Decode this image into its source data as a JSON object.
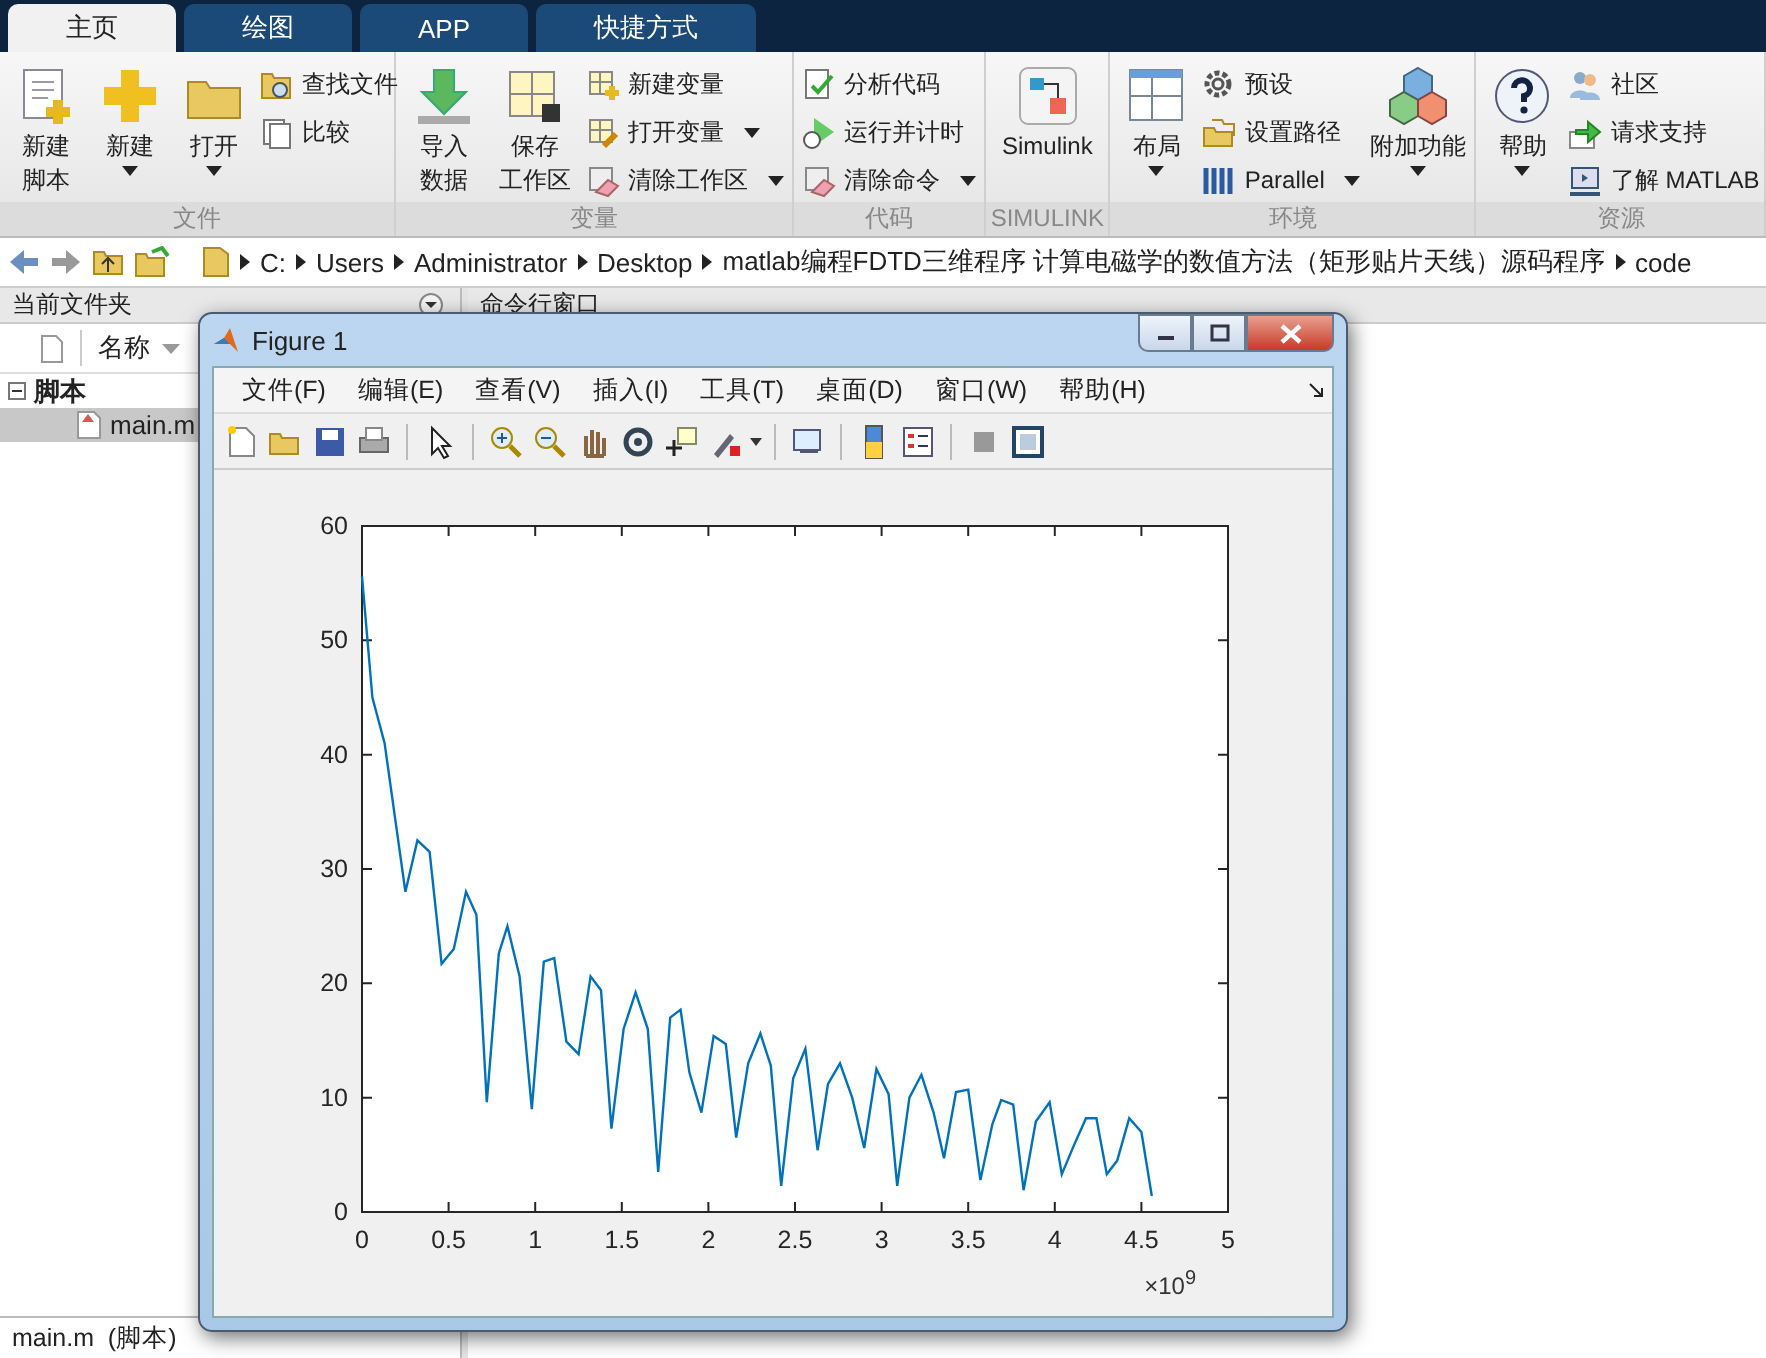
{
  "tabs": [
    {
      "label": "主页",
      "selected": true
    },
    {
      "label": "绘图",
      "selected": false
    },
    {
      "label": "APP",
      "selected": false
    },
    {
      "label": "快捷方式",
      "selected": false
    }
  ],
  "ribbon": {
    "groups": [
      {
        "label": "文件",
        "items": [
          {
            "kind": "large",
            "lines": [
              "新建",
              "脚本"
            ],
            "dropdown": false
          },
          {
            "kind": "large",
            "lines": [
              "新建"
            ],
            "dropdown": true
          },
          {
            "kind": "large",
            "lines": [
              "打开"
            ],
            "dropdown": true
          },
          {
            "kind": "small",
            "label": "查找文件",
            "dropdown": false
          },
          {
            "kind": "small",
            "label": "比较",
            "dropdown": false
          }
        ]
      },
      {
        "label": "变量",
        "items": [
          {
            "kind": "large",
            "lines": [
              "导入",
              "数据"
            ],
            "dropdown": false
          },
          {
            "kind": "large",
            "lines": [
              "保存",
              "工作区"
            ],
            "dropdown": false
          },
          {
            "kind": "small",
            "label": "新建变量",
            "dropdown": false
          },
          {
            "kind": "small",
            "label": "打开变量",
            "dropdown": true
          },
          {
            "kind": "small",
            "label": "清除工作区",
            "dropdown": true
          }
        ]
      },
      {
        "label": "代码",
        "items": [
          {
            "kind": "small",
            "label": "分析代码",
            "dropdown": false
          },
          {
            "kind": "small",
            "label": "运行并计时",
            "dropdown": false
          },
          {
            "kind": "small",
            "label": "清除命令",
            "dropdown": true
          }
        ]
      },
      {
        "label": "SIMULINK",
        "items": [
          {
            "kind": "large",
            "lines": [
              "Simulink"
            ],
            "dropdown": false
          }
        ]
      },
      {
        "label": "环境",
        "items": [
          {
            "kind": "large",
            "lines": [
              "布局"
            ],
            "dropdown": true
          },
          {
            "kind": "small",
            "label": "预设",
            "dropdown": false
          },
          {
            "kind": "small",
            "label": "设置路径",
            "dropdown": false
          },
          {
            "kind": "small",
            "label": "Parallel",
            "dropdown": true
          },
          {
            "kind": "large",
            "lines": [
              "附加功能"
            ],
            "dropdown": true
          }
        ]
      },
      {
        "label": "资源",
        "items": [
          {
            "kind": "large",
            "lines": [
              "帮助"
            ],
            "dropdown": true
          },
          {
            "kind": "small",
            "label": "社区",
            "dropdown": false
          },
          {
            "kind": "small",
            "label": "请求支持",
            "dropdown": false
          },
          {
            "kind": "small",
            "label": "了解 MATLAB",
            "dropdown": false
          }
        ]
      }
    ]
  },
  "path": [
    "C:",
    "Users",
    "Administrator",
    "Desktop",
    "matlab编程FDTD三维程序 计算电磁学的数值方法（矩形贴片天线）源码程序",
    "code"
  ],
  "file_panel": {
    "title": "当前文件夹",
    "column": "名称",
    "tree": [
      {
        "label": "脚本",
        "expanded": true,
        "children": [
          {
            "label": "main.m",
            "selected": true
          }
        ]
      }
    ],
    "details": "main.m  (脚本)"
  },
  "command_window": {
    "title": "命令行窗口"
  },
  "figure": {
    "title": "Figure 1",
    "menu": [
      "文件(F)",
      "编辑(E)",
      "查看(V)",
      "插入(I)",
      "工具(T)",
      "桌面(D)",
      "窗口(W)",
      "帮助(H)"
    ],
    "chart_data": {
      "type": "line",
      "x": [
        0,
        0.06,
        0.13,
        0.25,
        0.32,
        0.39,
        0.46,
        0.53,
        0.6,
        0.66,
        0.72,
        0.79,
        0.84,
        0.91,
        0.98,
        1.05,
        1.11,
        1.18,
        1.25,
        1.32,
        1.38,
        1.44,
        1.51,
        1.58,
        1.65,
        1.71,
        1.78,
        1.84,
        1.89,
        1.96,
        2.03,
        2.1,
        2.16,
        2.23,
        2.3,
        2.36,
        2.42,
        2.49,
        2.56,
        2.63,
        2.69,
        2.76,
        2.83,
        2.9,
        2.97,
        3.04,
        3.09,
        3.16,
        3.23,
        3.3,
        3.36,
        3.43,
        3.5,
        3.57,
        3.64,
        3.69,
        3.76,
        3.82,
        3.89,
        3.97,
        4.04,
        4.11,
        4.18,
        4.24,
        4.3,
        4.36,
        4.43,
        4.5,
        4.56
      ],
      "series": [
        {
          "color": "#0072bd",
          "values": [
            55.6,
            45,
            41,
            28,
            32.5,
            31.5,
            21.7,
            23,
            28,
            26,
            9.6,
            22.6,
            25,
            20.6,
            9,
            21.9,
            22.2,
            14.9,
            13.8,
            20.6,
            19.4,
            7.3,
            16,
            19.2,
            16,
            3.5,
            17,
            17.7,
            12.2,
            8.7,
            15.4,
            14.7,
            6.5,
            13,
            15.6,
            12.8,
            2.3,
            11.7,
            14.3,
            5.4,
            11.2,
            13,
            10,
            5.6,
            12.5,
            10.3,
            2.3,
            10,
            12,
            8.7,
            4.7,
            10.5,
            10.7,
            2.8,
            7.7,
            9.8,
            9.4,
            1.9,
            7.9,
            9.6,
            3.3,
            5.8,
            8.2,
            8.2,
            3.3,
            4.5,
            8.2,
            7,
            1.4
          ]
        }
      ],
      "xlim": [
        0,
        5
      ],
      "ylim": [
        0,
        60
      ],
      "xticks": [
        0,
        0.5,
        1,
        1.5,
        2,
        2.5,
        3,
        3.5,
        4,
        4.5,
        5
      ],
      "yticks": [
        0,
        10,
        20,
        30,
        40,
        50,
        60
      ],
      "annotations": [
        {
          "text": "×10$^{9}$"
        }
      ]
    }
  }
}
